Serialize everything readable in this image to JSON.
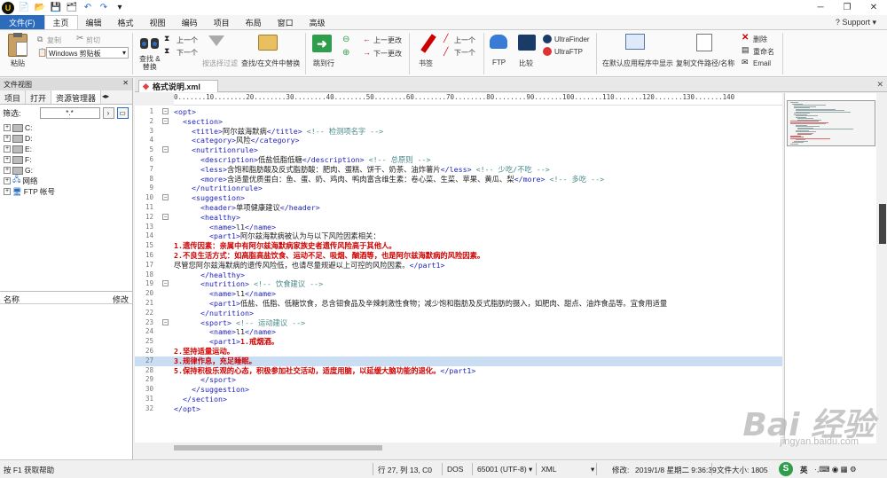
{
  "titlebar": {
    "minimize": "─",
    "restore": "❐",
    "close": "✕"
  },
  "menu": {
    "tabs": [
      "文件(F)",
      "主页",
      "编辑",
      "格式",
      "视图",
      "编码",
      "项目",
      "布局",
      "窗口",
      "高级"
    ],
    "support": "Support"
  },
  "ribbon": {
    "paste": "粘贴",
    "copy": "复制",
    "cut": "剪切",
    "clipboard": "Windows 剪贴板",
    "find_replace": "查找 &\n替换",
    "prev": "上一个",
    "next": "下一个",
    "filter": "按选择过滤",
    "find_in_files": "查找/在文件中替换",
    "goto_line": "跳到行",
    "prev_change": "上一更改",
    "next_change": "下一更改",
    "bookmark": "书签",
    "bm_prev": "上一个",
    "bm_next": "下一个",
    "ftp": "FTP",
    "compare": "比较",
    "ultrafinder": "UltraFinder",
    "ultraftp": "UltraFTP",
    "open_default": "在默认应用程序中显示",
    "copy_path": "复制文件路径/名称",
    "delete": "删除",
    "rename": "重命名",
    "email": "Email"
  },
  "left_panel": {
    "title": "文件视图",
    "tabs": [
      "项目",
      "打开",
      "资源管理器"
    ],
    "filter_label": "筛选:",
    "filter_value": "*.*",
    "tree": [
      "C:",
      "D:",
      "E:",
      "F:",
      "G:",
      "网络",
      "FTP 帐号"
    ],
    "props_name": "名称",
    "props_mod": "修改"
  },
  "editor": {
    "tab_title": "格式说明.xml",
    "ruler": "0.......10........20........30........40........50........60........70........80........90.......100.......110.......120.......130.......140",
    "lines": [
      {
        "n": "1",
        "indent": 0,
        "parts": [
          [
            "tag",
            "<opt>"
          ]
        ]
      },
      {
        "n": "2",
        "indent": 1,
        "parts": [
          [
            "tag",
            "<section>"
          ]
        ]
      },
      {
        "n": "3",
        "indent": 2,
        "parts": [
          [
            "tag",
            "<title>"
          ],
          [
            "txt",
            "阿尔兹海默病"
          ],
          [
            "tag",
            "</title>"
          ],
          [
            "cmt",
            " <!-- 检测项名字 -->"
          ]
        ]
      },
      {
        "n": "4",
        "indent": 2,
        "parts": [
          [
            "tag",
            "<category>"
          ],
          [
            "txt",
            "风险"
          ],
          [
            "tag",
            "</category>"
          ]
        ]
      },
      {
        "n": "5",
        "indent": 2,
        "parts": [
          [
            "tag",
            "<nutritionrule>"
          ]
        ]
      },
      {
        "n": "6",
        "indent": 3,
        "parts": [
          [
            "tag",
            "<description>"
          ],
          [
            "txt",
            "低盐低脂低糖"
          ],
          [
            "tag",
            "</description>"
          ],
          [
            "cmt",
            " <!-- 总原则 -->"
          ]
        ]
      },
      {
        "n": "7",
        "indent": 3,
        "parts": [
          [
            "tag",
            "<less>"
          ],
          [
            "txt",
            "含饱和脂肪酸及反式脂肪酸：肥肉、蛋糕、饼干、奶茶、油炸薯片"
          ],
          [
            "tag",
            "</less>"
          ],
          [
            "cmt",
            " <!-- 少吃/不吃 -->"
          ]
        ]
      },
      {
        "n": "8",
        "indent": 3,
        "parts": [
          [
            "tag",
            "<more>"
          ],
          [
            "txt",
            "含适量优质蛋白：鱼、蛋、奶、鸡肉、鸭肉富含维生素：卷心菜、生菜、苹果、黄瓜、梨"
          ],
          [
            "tag",
            "</more>"
          ],
          [
            "cmt",
            " <!-- 多吃 -->"
          ]
        ]
      },
      {
        "n": "9",
        "indent": 2,
        "parts": [
          [
            "tag",
            "</nutritionrule>"
          ]
        ]
      },
      {
        "n": "10",
        "indent": 2,
        "parts": [
          [
            "tag",
            "<suggestion>"
          ]
        ]
      },
      {
        "n": "11",
        "indent": 3,
        "parts": [
          [
            "tag",
            "<header>"
          ],
          [
            "txt",
            "单项健康建议"
          ],
          [
            "tag",
            "</header>"
          ]
        ]
      },
      {
        "n": "12",
        "indent": 3,
        "parts": [
          [
            "tag",
            "<healthy>"
          ]
        ]
      },
      {
        "n": "13",
        "indent": 4,
        "parts": [
          [
            "tag",
            "<name>"
          ],
          [
            "txt",
            "l1"
          ],
          [
            "tag",
            "</name>"
          ]
        ]
      },
      {
        "n": "14",
        "indent": 4,
        "parts": [
          [
            "tag",
            "<part1>"
          ],
          [
            "txt",
            "阿尔兹海默病被认为与以下风险因素相关："
          ]
        ]
      },
      {
        "n": "15",
        "indent": 0,
        "parts": [
          [
            "red",
            "1.遗传因素：亲属中有阿尔兹海默病家族史者遗传风险高于其他人。"
          ]
        ]
      },
      {
        "n": "16",
        "indent": 0,
        "parts": [
          [
            "red",
            "2.不良生活方式：如高脂高盐饮食、运动不足、吸烟、酗酒等，也是阿尔兹海默病的风险因素。"
          ]
        ]
      },
      {
        "n": "17",
        "indent": 0,
        "parts": [
          [
            "txt",
            "尽管您阿尔兹海默病的遗传风险低，也请尽量规避以上可控的风险因素。"
          ],
          [
            "tag",
            "</part1>"
          ]
        ]
      },
      {
        "n": "18",
        "indent": 3,
        "parts": [
          [
            "tag",
            "</healthy>"
          ]
        ]
      },
      {
        "n": "19",
        "indent": 3,
        "parts": [
          [
            "tag",
            "<nutrition>"
          ],
          [
            "cmt",
            " <!-- 饮食建议 -->"
          ]
        ]
      },
      {
        "n": "20",
        "indent": 4,
        "parts": [
          [
            "tag",
            "<name>"
          ],
          [
            "txt",
            "l1"
          ],
          [
            "tag",
            "</name>"
          ]
        ]
      },
      {
        "n": "21",
        "indent": 4,
        "parts": [
          [
            "tag",
            "<part1>"
          ],
          [
            "txt",
            "低盐、低脂、低糖饮食，总含钼食品及辛辣刺激性食物；减少饱和脂肪及反式脂肪的摄入，如肥肉、甜点、油炸食品等。宜食用适量"
          ]
        ]
      },
      {
        "n": "22",
        "indent": 3,
        "parts": [
          [
            "tag",
            "</nutrition>"
          ]
        ]
      },
      {
        "n": "23",
        "indent": 3,
        "parts": [
          [
            "tag",
            "<sport>"
          ],
          [
            "cmt",
            " <!-- 运动建议 -->"
          ]
        ]
      },
      {
        "n": "24",
        "indent": 4,
        "parts": [
          [
            "tag",
            "<name>"
          ],
          [
            "txt",
            "l1"
          ],
          [
            "tag",
            "</name>"
          ]
        ]
      },
      {
        "n": "25",
        "indent": 4,
        "parts": [
          [
            "tag",
            "<part1>"
          ],
          [
            "red",
            "1.戒烟酒。"
          ]
        ]
      },
      {
        "n": "26",
        "indent": 0,
        "parts": [
          [
            "red",
            "2.坚持适量运动。"
          ]
        ]
      },
      {
        "n": "27",
        "indent": 0,
        "parts": [
          [
            "red",
            "3.规律作息，充足睡眠。"
          ]
        ]
      },
      {
        "n": "28",
        "indent": 0,
        "parts": [
          [
            "red",
            "5.保持积极乐观的心态，积极参加社交活动，适度用脑，以延缓大脑功能的退化。"
          ],
          [
            "tag",
            "</part1>"
          ]
        ]
      },
      {
        "n": "29",
        "indent": 3,
        "parts": [
          [
            "tag",
            "</sport>"
          ]
        ]
      },
      {
        "n": "30",
        "indent": 2,
        "parts": [
          [
            "tag",
            "</suggestion>"
          ]
        ]
      },
      {
        "n": "31",
        "indent": 1,
        "parts": [
          [
            "tag",
            "</section>"
          ]
        ]
      },
      {
        "n": "32",
        "indent": 0,
        "parts": [
          [
            "tag",
            "</opt>"
          ]
        ]
      }
    ]
  },
  "status": {
    "help": "按 F1 获取帮助",
    "position": "行 27, 列 13, C0",
    "line_ending": "DOS",
    "encoding": "65001 (UTF-8)",
    "syntax": "XML",
    "modified": "修改:",
    "date": "2019/1/8 星期二 9:36:39",
    "file_size": "文件大小: 1805",
    "ime": "英"
  },
  "watermark": {
    "text": "Bai 经验",
    "url": "jingyan.baidu.com"
  }
}
